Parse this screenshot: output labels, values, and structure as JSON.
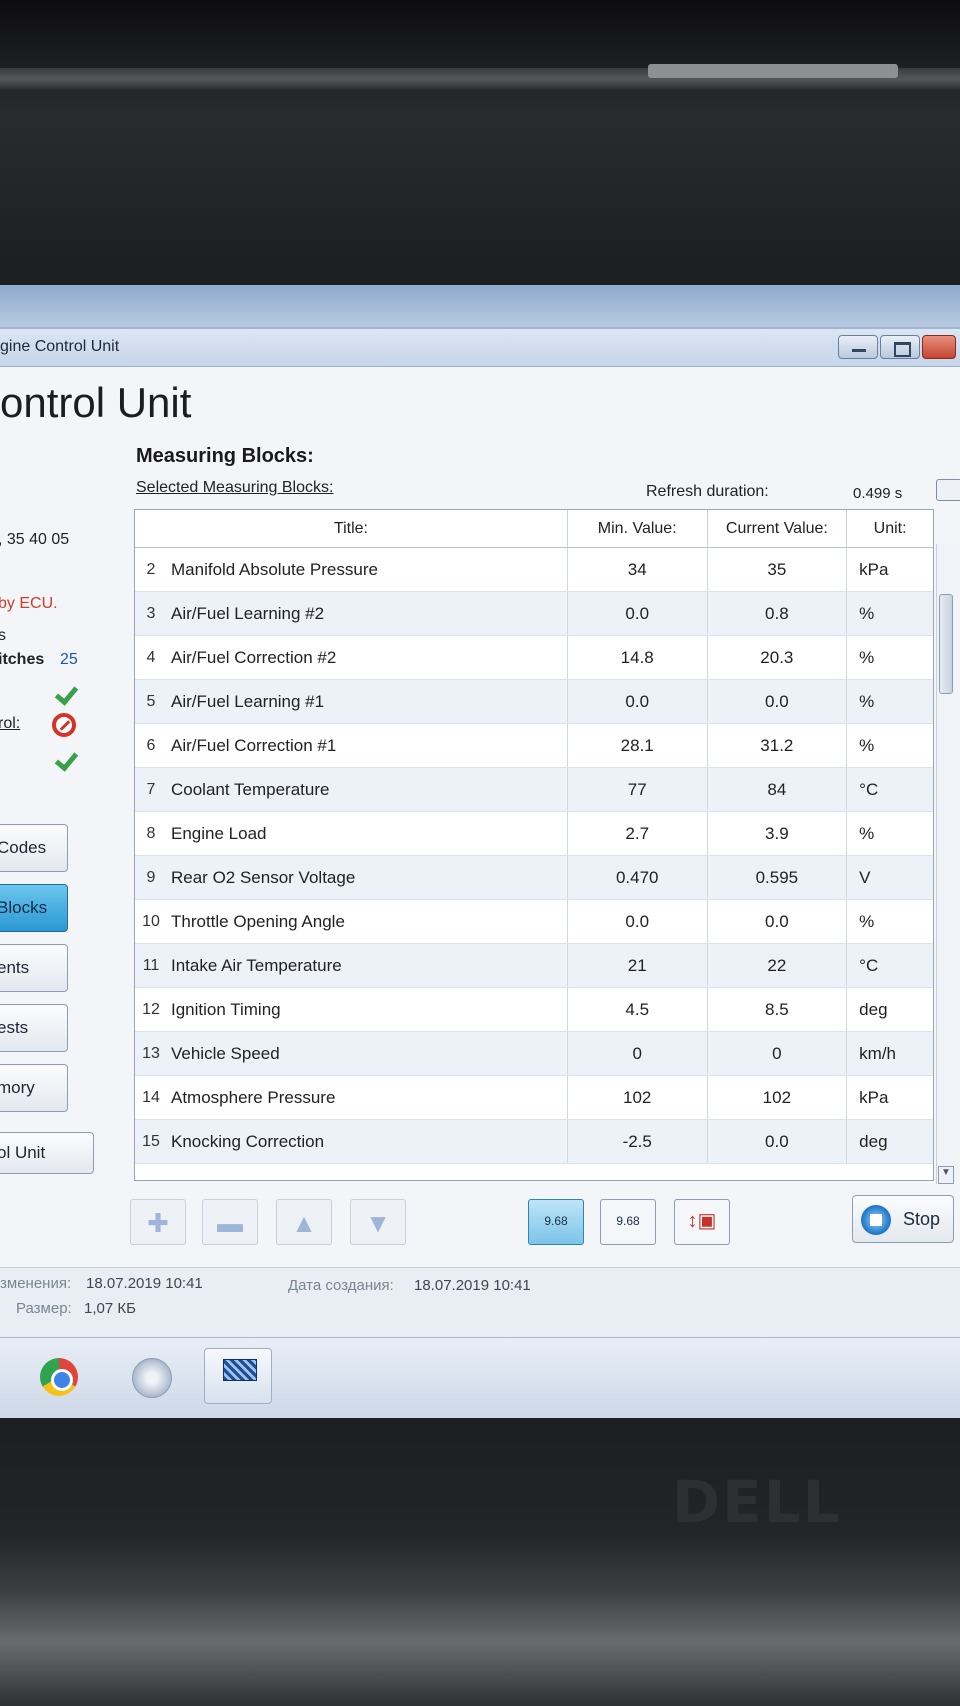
{
  "window": {
    "title": "gine Control Unit",
    "heading": "ontrol Unit"
  },
  "left_panel": {
    "texts": [
      ", 35 40 05",
      "by ECU.",
      "s",
      "itches",
      "25",
      "rol:"
    ],
    "status_icons": [
      "check-icon",
      "stop-icon",
      "check-icon"
    ],
    "accent_color": "#d33b26",
    "buttons": [
      "Codes",
      "Blocks",
      "ents",
      "ests",
      "mory"
    ],
    "active_button": "Blocks",
    "unit_button": "ol Unit"
  },
  "measuring": {
    "title": "Measuring Blocks:",
    "subtitle": "Selected Measuring Blocks:",
    "refresh_label": "Refresh duration:",
    "refresh_value": "0.499 s",
    "columns": {
      "title": "Title:",
      "min": "Min. Value:",
      "current": "Current Value:",
      "unit": "Unit:"
    },
    "rows": [
      {
        "num": "2",
        "title": "Manifold Absolute Pressure",
        "min": "34",
        "current": "35",
        "unit": "kPa"
      },
      {
        "num": "3",
        "title": "Air/Fuel Learning #2",
        "min": "0.0",
        "current": "0.8",
        "unit": "%"
      },
      {
        "num": "4",
        "title": "Air/Fuel Correction #2",
        "min": "14.8",
        "current": "20.3",
        "unit": "%"
      },
      {
        "num": "5",
        "title": "Air/Fuel Learning #1",
        "min": "0.0",
        "current": "0.0",
        "unit": "%"
      },
      {
        "num": "6",
        "title": "Air/Fuel Correction #1",
        "min": "28.1",
        "current": "31.2",
        "unit": "%"
      },
      {
        "num": "7",
        "title": "Coolant Temperature",
        "min": "77",
        "current": "84",
        "unit": "°C"
      },
      {
        "num": "8",
        "title": "Engine Load",
        "min": "2.7",
        "current": "3.9",
        "unit": "%"
      },
      {
        "num": "9",
        "title": "Rear O2 Sensor Voltage",
        "min": "0.470",
        "current": "0.595",
        "unit": "V"
      },
      {
        "num": "10",
        "title": "Throttle Opening Angle",
        "min": "0.0",
        "current": "0.0",
        "unit": "%"
      },
      {
        "num": "11",
        "title": "Intake Air Temperature",
        "min": "21",
        "current": "22",
        "unit": "°C"
      },
      {
        "num": "12",
        "title": "Ignition Timing",
        "min": "4.5",
        "current": "8.5",
        "unit": "deg"
      },
      {
        "num": "13",
        "title": "Vehicle Speed",
        "min": "0",
        "current": "0",
        "unit": "km/h"
      },
      {
        "num": "14",
        "title": "Atmosphere Pressure",
        "min": "102",
        "current": "102",
        "unit": "kPa"
      },
      {
        "num": "15",
        "title": "Knocking Correction",
        "min": "-2.5",
        "current": "0.0",
        "unit": "deg"
      }
    ]
  },
  "toolbar": {
    "icon_labels": [
      "9.68",
      "9.68"
    ],
    "stop_label": "Stop"
  },
  "explorer": {
    "modified_label": "зменения:",
    "modified_value": "18.07.2019 10:41",
    "created_label": "Дата создания:",
    "created_value": "18.07.2019 10:41",
    "size_label": "Размер:",
    "size_value": "1,07 КБ"
  },
  "taskbar": {
    "items": [
      "chrome-icon",
      "media-player-icon",
      "vcds-icon"
    ]
  },
  "laptop_brand": "DELL"
}
